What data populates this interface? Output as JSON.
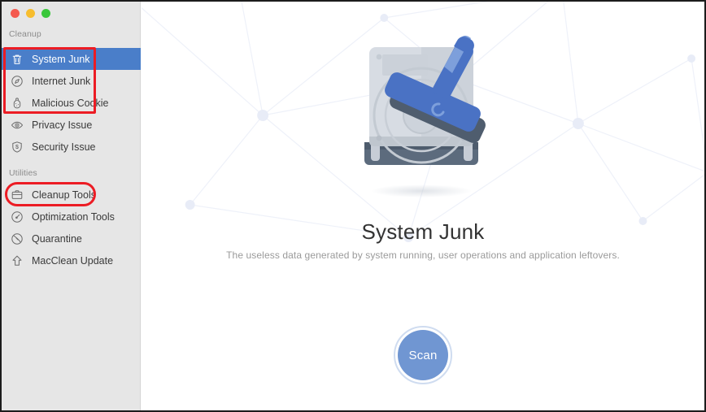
{
  "window": {
    "traffic_lights": [
      {
        "name": "close",
        "color": "#f4594e"
      },
      {
        "name": "minimize",
        "color": "#f7bd2e"
      },
      {
        "name": "maximize",
        "color": "#3ac73b"
      }
    ]
  },
  "sidebar": {
    "groups": [
      {
        "label": "Cleanup",
        "items": [
          {
            "label": "System Junk",
            "icon": "trash-icon",
            "selected": true
          },
          {
            "label": "Internet Junk",
            "icon": "compass-icon",
            "selected": false
          },
          {
            "label": "Malicious Cookie",
            "icon": "cookie-icon",
            "selected": false
          },
          {
            "label": "Privacy Issue",
            "icon": "eye-icon",
            "selected": false
          },
          {
            "label": "Security Issue",
            "icon": "shield-icon",
            "selected": false
          }
        ]
      },
      {
        "label": "Utilities",
        "items": [
          {
            "label": "Cleanup Tools",
            "icon": "toolbox-icon",
            "selected": false
          },
          {
            "label": "Optimization Tools",
            "icon": "speedometer-icon",
            "selected": false
          },
          {
            "label": "Quarantine",
            "icon": "no-entry-icon",
            "selected": false
          },
          {
            "label": "MacClean Update",
            "icon": "up-arrow-icon",
            "selected": false
          }
        ]
      }
    ],
    "selected_color": "#4a7ec9"
  },
  "annotations": {
    "accent_color": "#ec1c24",
    "boxes": [
      {
        "name": "cleanup-group-highlight",
        "shape": "rectangle"
      },
      {
        "name": "cleanup-tools-highlight",
        "shape": "rounded-rectangle"
      }
    ]
  },
  "main": {
    "illustration": "hard-drive-with-squeegee-illustration",
    "title": "System Junk",
    "description": "The useless data generated by system running, user operations and application leftovers.",
    "scan_button": {
      "label": "Scan",
      "color": "#7096d2",
      "ring_color": "#cfdcf0"
    }
  }
}
